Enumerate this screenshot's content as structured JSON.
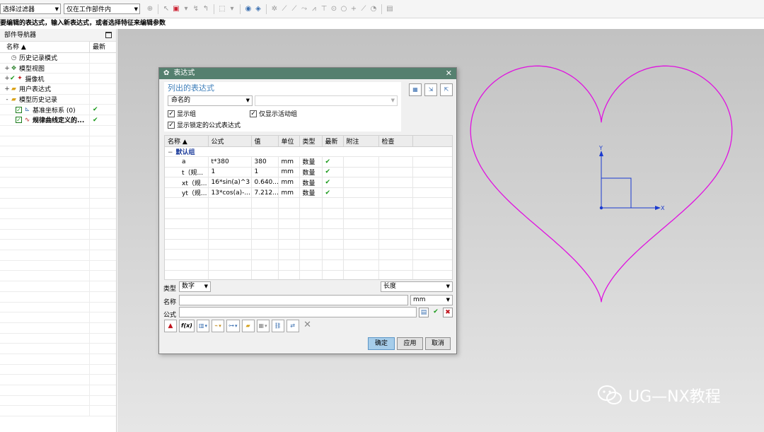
{
  "toolbar": {
    "filter_select": "选择过滤器",
    "scope_select": "仅在工作部件内"
  },
  "cue_line": "要编辑的表达式，输入新表达式，或者选择特征来编辑参数",
  "navigator": {
    "title": "部件导航器",
    "col_name": "名称 ▲",
    "col_latest": "最新",
    "items": [
      {
        "label": "历史记录模式",
        "icon": "clock-icon",
        "expander": "",
        "latest": ""
      },
      {
        "label": "模型视图",
        "icon": "model-views-icon",
        "expander": "+",
        "latest": ""
      },
      {
        "label": "摄像机",
        "icon": "camera-icon",
        "expander": "+",
        "latest": ""
      },
      {
        "label": "用户表达式",
        "icon": "folder-icon",
        "expander": "+",
        "latest": ""
      },
      {
        "label": "模型历史记录",
        "icon": "folder-open-icon",
        "expander": "-",
        "latest": ""
      },
      {
        "label": "基准坐标系 (0)",
        "icon": "datum-csys-icon",
        "expander": "",
        "latest": "✔"
      },
      {
        "label": "规律曲线定义的...",
        "icon": "law-curve-icon",
        "expander": "",
        "latest": "✔"
      }
    ]
  },
  "dialog": {
    "title": "表达式",
    "section_title": "列出的表达式",
    "list_select": "命名的",
    "filter_select": "",
    "show_groups": "显示组",
    "show_active_group": "仅显示活动组",
    "show_locked": "显示锁定的公式表达式",
    "table": {
      "columns": [
        "名称 ▲",
        "公式",
        "值",
        "单位",
        "类型",
        "最新",
        "附注",
        "检查"
      ],
      "group_label": "默认组",
      "rows": [
        {
          "name": "a",
          "formula": "t*380",
          "value": "380",
          "unit": "mm",
          "type": "数量",
          "latest": "✔"
        },
        {
          "name": "t（规...",
          "formula": "1",
          "value": "1",
          "unit": "mm",
          "type": "数量",
          "latest": "✔"
        },
        {
          "name": "xt（规...",
          "formula": "16*sin(a)^3",
          "value": "0.640...",
          "unit": "mm",
          "type": "数量",
          "latest": "✔"
        },
        {
          "name": "yt（规...",
          "formula": "13*cos(a)-...",
          "value": "7.212...",
          "unit": "mm",
          "type": "数量",
          "latest": "✔"
        }
      ]
    },
    "type_label": "类型",
    "type_value": "数字",
    "dimension_value": "长度",
    "name_label": "名称",
    "name_value": "",
    "unit_value": "mm",
    "formula_label": "公式",
    "formula_value": "",
    "fx_label": "f(x)",
    "ok_button": "确定",
    "apply_button": "应用",
    "cancel_button": "取消"
  },
  "viewport": {
    "curve_color": "#e010e0",
    "axis_color": "#1a3ad0",
    "axis_x_label": "X",
    "axis_y_label": "Y"
  },
  "watermark": "UG—NX教程"
}
